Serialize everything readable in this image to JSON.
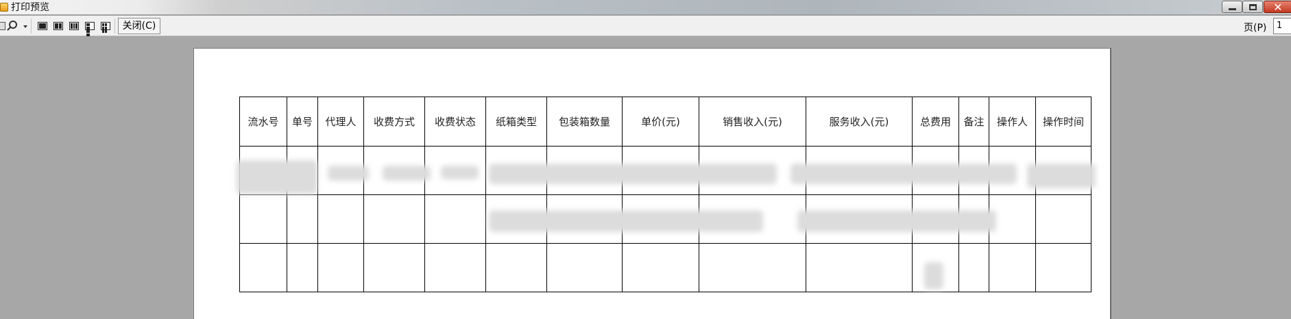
{
  "window": {
    "title": "打印预览"
  },
  "toolbar": {
    "close_label": "关闭(C)",
    "page_label": "页(P)",
    "page_value": "1"
  },
  "report": {
    "columns": [
      "流水号",
      "单号",
      "代理人",
      "收费方式",
      "收费状态",
      "纸箱类型",
      "包装箱数量",
      "单价(元)",
      "销售收入(元)",
      "服务收入(元)",
      "总费用",
      "备注",
      "操作人",
      "操作时间"
    ]
  }
}
